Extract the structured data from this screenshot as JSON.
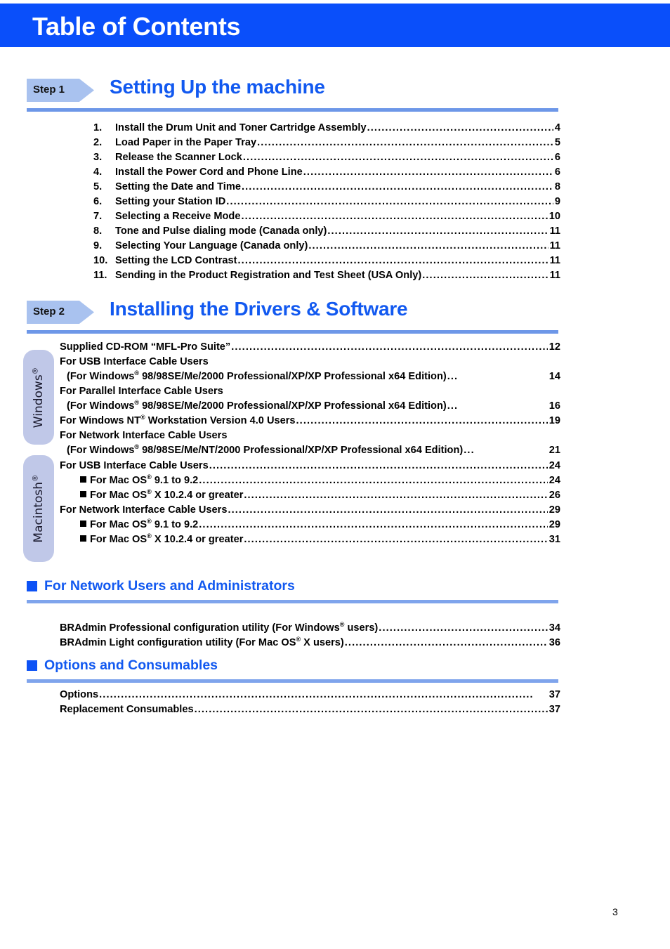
{
  "banner": {
    "title": "Table of Contents"
  },
  "steps": [
    {
      "badge": "Step 1",
      "title": "Setting Up the machine",
      "entries": [
        {
          "num": "1.",
          "text": "Install the Drum Unit and Toner Cartridge Assembly",
          "page": "4"
        },
        {
          "num": "2.",
          "text": "Load Paper in the Paper Tray",
          "page": "5"
        },
        {
          "num": "3.",
          "text": "Release the Scanner Lock",
          "page": "6"
        },
        {
          "num": "4.",
          "text": "Install the Power Cord and Phone Line",
          "page": "6"
        },
        {
          "num": "5.",
          "text": "Setting the Date and Time",
          "page": "8"
        },
        {
          "num": "6.",
          "text": "Setting your Station ID",
          "page": "9"
        },
        {
          "num": "7.",
          "text": "Selecting a Receive Mode",
          "page": "10"
        },
        {
          "num": "8.",
          "text": "Tone and Pulse dialing mode (Canada only)",
          "page": "11"
        },
        {
          "num": "9.",
          "text": "Selecting Your Language (Canada only)",
          "page": "11"
        },
        {
          "num": "10.",
          "text": "Setting the LCD Contrast",
          "page": "11"
        },
        {
          "num": "11.",
          "text": "Sending in the Product Registration and Test Sheet (USA Only)",
          "page": "11"
        }
      ]
    },
    {
      "badge": "Step 2",
      "title": "Installing the Drivers & Software"
    }
  ],
  "step2_entries": [
    {
      "id": "e1",
      "kind": "leader",
      "text": "Supplied CD-ROM “MFL-Pro Suite”",
      "page": "12"
    },
    {
      "id": "e2",
      "kind": "plain",
      "text": "For USB Interface Cable Users"
    },
    {
      "id": "e3",
      "kind": "leader-reg",
      "pre": "(For Windows",
      "post": " 98/98SE/Me/2000 Professional/XP/XP Professional x64 Edition)",
      "dots": "...",
      "page": "14",
      "indent": 10
    },
    {
      "id": "e4",
      "kind": "plain",
      "text": "For Parallel Interface Cable Users"
    },
    {
      "id": "e5",
      "kind": "leader-reg",
      "pre": "(For Windows",
      "post": " 98/98SE/Me/2000 Professional/XP/XP Professional x64 Edition)",
      "dots": "...",
      "page": "16",
      "indent": 10
    },
    {
      "id": "e6",
      "kind": "leader-reg-mid",
      "pre": "For Windows NT",
      "post": " Workstation Version 4.0 Users",
      "page": "19"
    },
    {
      "id": "e7",
      "kind": "plain",
      "text": "For Network Interface Cable Users"
    },
    {
      "id": "e8",
      "kind": "leader-reg",
      "pre": "(For Windows",
      "post": " 98/98SE/Me/NT/2000 Professional/XP/XP Professional x64 Edition)",
      "dots": "...",
      "page": "21",
      "indent": 10
    }
  ],
  "mac_entries": [
    {
      "id": "m1",
      "kind": "leader",
      "text": "For USB Interface Cable Users",
      "page": "24"
    },
    {
      "id": "m2",
      "kind": "bullet-reg",
      "pre": "For Mac OS",
      "post": " 9.1 to 9.2",
      "page": "24",
      "indent": 29
    },
    {
      "id": "m3",
      "kind": "bullet-reg",
      "pre": "For Mac OS",
      "post": " X 10.2.4 or greater",
      "page": "26",
      "indent": 29
    },
    {
      "id": "m4",
      "kind": "leader",
      "text": "For Network Interface Cable Users",
      "page": "29"
    },
    {
      "id": "m5",
      "kind": "bullet-reg",
      "pre": "For Mac OS",
      "post": " 9.1 to 9.2",
      "page": "29",
      "indent": 29
    },
    {
      "id": "m6",
      "kind": "bullet-reg",
      "pre": "For Mac OS",
      "post": " X 10.2.4 or greater",
      "page": "31",
      "indent": 29
    }
  ],
  "side_tabs": [
    {
      "label": "Windows",
      "reg": true
    },
    {
      "label": "Macintosh",
      "reg": true
    }
  ],
  "sections": [
    {
      "title": "For Network Users and Administrators",
      "entries": [
        {
          "kind": "reg-mid",
          "pre": "BRAdmin Professional configuration utility (For Windows",
          "post": " users)",
          "page": "34"
        },
        {
          "kind": "reg-mid",
          "pre": "BRAdmin Light configuration utility (For Mac OS",
          "post": " X users)",
          "page": "36"
        }
      ]
    },
    {
      "title": "Options and Consumables",
      "entries": [
        {
          "kind": "leader",
          "text": "Options",
          "page": "37"
        },
        {
          "kind": "leader",
          "text": "Replacement Consumables",
          "page": "37"
        }
      ]
    }
  ],
  "footer": {
    "page_number": "3"
  },
  "colors": {
    "banner_blue": "#0A4FFA",
    "title_blue": "#1259F0",
    "badge_blue": "#A9C2EF",
    "rule_blue": "#6D97E8",
    "tab_lavender": "#C0C8E8"
  }
}
